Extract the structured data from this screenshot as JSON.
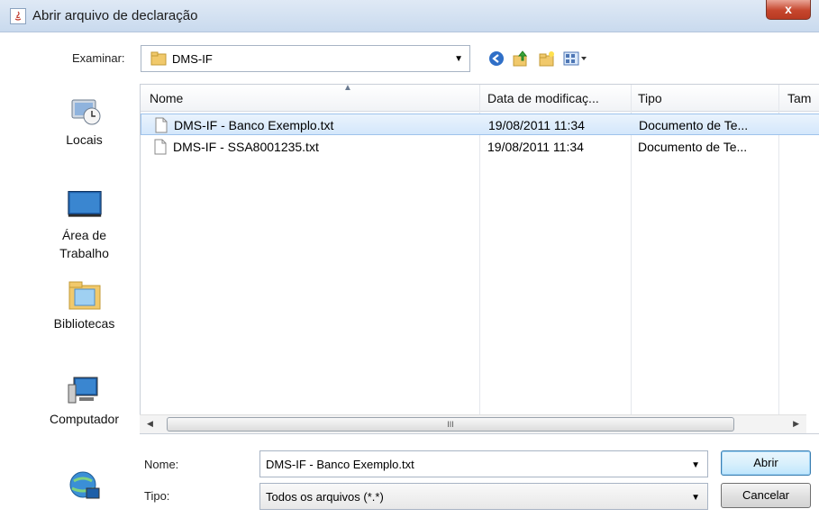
{
  "window": {
    "title": "Abrir arquivo de declaração",
    "close_label": "x"
  },
  "lookin": {
    "label": "Examinar:",
    "value": "DMS-IF"
  },
  "toolbar": {
    "icons": [
      "back-icon",
      "up-folder-icon",
      "new-folder-icon",
      "view-menu-icon"
    ]
  },
  "places": [
    {
      "label": "Locais",
      "icon": "recent-places-icon"
    },
    {
      "label": "Área de Trabalho",
      "icon": "desktop-icon"
    },
    {
      "label": "Bibliotecas",
      "icon": "libraries-icon"
    },
    {
      "label": "Computador",
      "icon": "computer-icon"
    },
    {
      "label": "",
      "icon": "network-icon"
    }
  ],
  "columns": [
    "Nome",
    "Data de modificaç...",
    "Tipo",
    "Tam"
  ],
  "files": [
    {
      "name": "DMS-IF - Banco Exemplo.txt",
      "date": "19/08/2011 11:34",
      "type": "Documento de Te...",
      "selected": true
    },
    {
      "name": "DMS-IF - SSA8001235.txt",
      "date": "19/08/2011 11:34",
      "type": "Documento de Te...",
      "selected": false
    }
  ],
  "scrollbar": {
    "thumb_label": "III"
  },
  "filename": {
    "label": "Nome:",
    "value": "DMS-IF - Banco Exemplo.txt"
  },
  "filetype": {
    "label": "Tipo:",
    "value": "Todos os arquivos (*.*)"
  },
  "buttons": {
    "open": "Abrir",
    "cancel": "Cancelar"
  }
}
